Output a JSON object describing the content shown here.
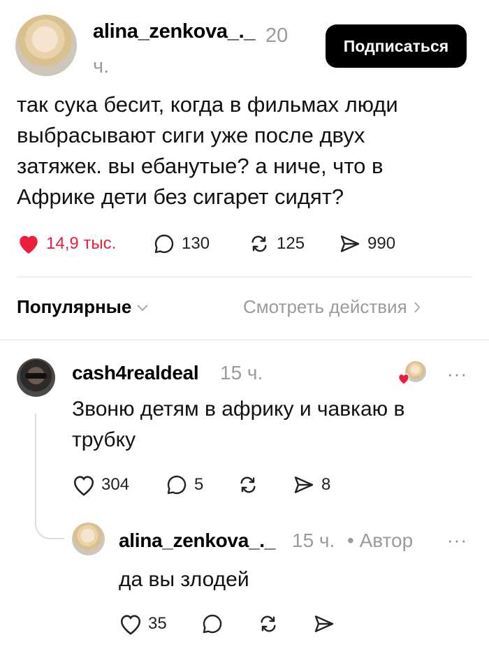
{
  "post": {
    "author": "alina_zenkova_._",
    "time": "20 ч.",
    "subscribe_label": "Подписаться",
    "text_lines": [
      "так сука бесит, когда в фильмах люди",
      "выбрасывают сиги уже после двух",
      "затяжек. вы ебанутые? а ниче, что в",
      "Африке дети без сигарет сидят?"
    ],
    "likes": "14,9 тыс.",
    "comments": "130",
    "reposts": "125",
    "shares": "990",
    "liked": true,
    "like_color": "#ee1d3b"
  },
  "filter": {
    "sort_label": "Популярные",
    "activity_label": "Смотреть действия"
  },
  "comment1": {
    "author": "cash4realdeal",
    "time": "15 ч.",
    "text_lines": [
      "Звоню детям в африку и чавкаю в",
      "трубку"
    ],
    "likes": "304",
    "comments": "5",
    "reposts": "",
    "shares": "8",
    "more": "···"
  },
  "reply1": {
    "author": "alina_zenkova_._",
    "time": "15 ч.",
    "author_badge": "• Автор",
    "text": "да вы злодей",
    "likes": "35",
    "more": "···"
  },
  "icons": {
    "heart": "heart-icon",
    "comment": "comment-icon",
    "repost": "repost-icon",
    "share": "share-icon",
    "chevron": "chevron-down-icon",
    "chevron_right": "chevron-right-icon"
  }
}
